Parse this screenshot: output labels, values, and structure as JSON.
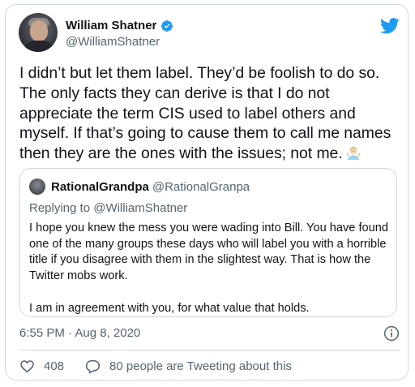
{
  "author": {
    "display_name": "William Shatner",
    "handle": "@WilliamShatner",
    "verified": true,
    "avatar_icon": "profile-photo"
  },
  "brand": {
    "icon": "twitter-bird-icon",
    "color": "#1d9bf0"
  },
  "tweet": {
    "text": "I didn’t but let them label. They’d be foolish to do so. The only facts they can derive is that I do not appreciate the term CIS used to label others and myself. If that’s going to cause them to call me names then they are the ones with the issues; not me.",
    "emoji": "man-shrugging-emoji",
    "timestamp": "6:55 PM · Aug 8, 2020"
  },
  "quoted_tweet": {
    "display_name": "RationalGrandpa",
    "handle": "@RationalGranpa",
    "replying_to": "Replying to @WilliamShatner",
    "paragraphs": [
      "I hope you knew the mess you were wading into Bill. You have found one of the many groups these days who will label you with a horrible title if you disagree with them in the slightest way. That is how the Twitter mobs work.",
      "I am in agreement with you, for what value that holds."
    ]
  },
  "actions": {
    "likes_count": "408",
    "replies_label": "80 people are Tweeting about this"
  },
  "colors": {
    "text_primary": "#0f1419",
    "text_secondary": "#536471",
    "border": "#cfd9de",
    "verified_badge": "#1d9bf0"
  }
}
